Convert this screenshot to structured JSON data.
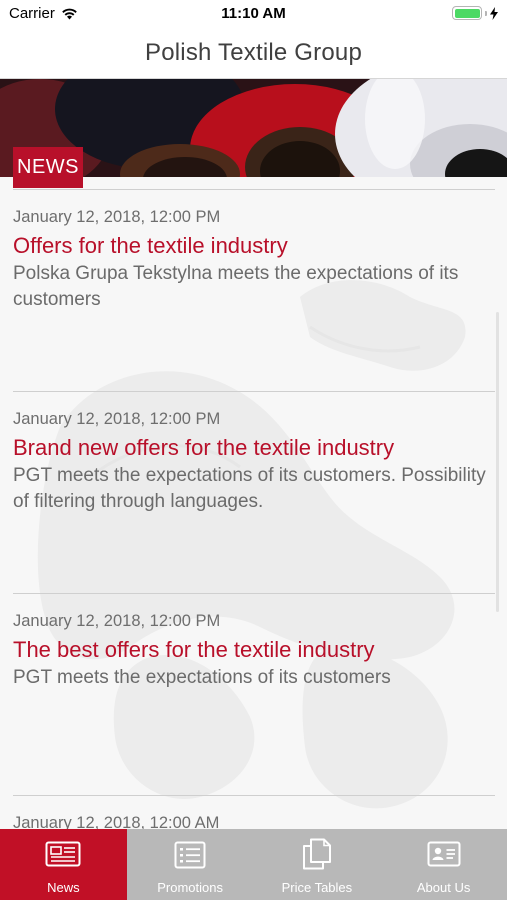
{
  "status_bar": {
    "carrier": "Carrier",
    "time": "11:10 AM",
    "battery_level": 1.0
  },
  "nav": {
    "title": "Polish Textile Group"
  },
  "banner": {
    "badge": "NEWS"
  },
  "news": [
    {
      "date": "January 12, 2018, 12:00 PM",
      "title": "Offers for the textile industry",
      "description": "Polska Grupa Tekstylna meets the expectations of its customers"
    },
    {
      "date": "January 12, 2018, 12:00 PM",
      "title": "Brand new offers for the textile industry",
      "description": "PGT meets the expectations of its customers. Possibility of filtering through languages."
    },
    {
      "date": "January 12, 2018, 12:00 PM",
      "title": "The best offers for the textile industry",
      "description": "PGT meets the expectations of its customers"
    },
    {
      "date": "January 12, 2018, 12:00 AM",
      "title": "",
      "description": ""
    }
  ],
  "tabs": [
    {
      "label": "News",
      "icon": "newspaper-icon",
      "active": true
    },
    {
      "label": "Promotions",
      "icon": "list-icon",
      "active": false
    },
    {
      "label": "Price Tables",
      "icon": "documents-icon",
      "active": false
    },
    {
      "label": "About Us",
      "icon": "contact-card-icon",
      "active": false
    }
  ],
  "colors": {
    "accent": "#b8102a",
    "tab_active": "#c11026",
    "tab_inactive": "#b8b8b8",
    "battery": "#4cd964"
  }
}
